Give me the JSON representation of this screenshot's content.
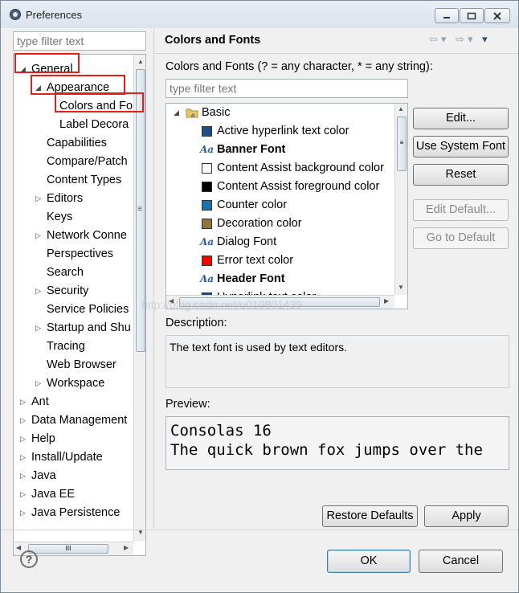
{
  "window": {
    "title": "Preferences"
  },
  "left": {
    "filter_placeholder": "type filter text",
    "tree": [
      {
        "label": "General",
        "expander": "◢",
        "level": 0
      },
      {
        "label": "Appearance",
        "expander": "◢",
        "level": 1
      },
      {
        "label": "Colors and Fo",
        "expander": "",
        "level": 2
      },
      {
        "label": "Label Decora",
        "expander": "",
        "level": 2
      },
      {
        "label": "Capabilities",
        "expander": "",
        "level": 1
      },
      {
        "label": "Compare/Patch",
        "expander": "",
        "level": 1
      },
      {
        "label": "Content Types",
        "expander": "",
        "level": 1
      },
      {
        "label": "Editors",
        "expander": "▷",
        "level": 1
      },
      {
        "label": "Keys",
        "expander": "",
        "level": 1
      },
      {
        "label": "Network Conne",
        "expander": "▷",
        "level": 1
      },
      {
        "label": "Perspectives",
        "expander": "",
        "level": 1
      },
      {
        "label": "Search",
        "expander": "",
        "level": 1
      },
      {
        "label": "Security",
        "expander": "▷",
        "level": 1
      },
      {
        "label": "Service Policies",
        "expander": "",
        "level": 1
      },
      {
        "label": "Startup and Shu",
        "expander": "▷",
        "level": 1
      },
      {
        "label": "Tracing",
        "expander": "",
        "level": 1
      },
      {
        "label": "Web Browser",
        "expander": "",
        "level": 1
      },
      {
        "label": "Workspace",
        "expander": "▷",
        "level": 1
      },
      {
        "label": "Ant",
        "expander": "▷",
        "level": 0
      },
      {
        "label": "Data Management",
        "expander": "▷",
        "level": 0
      },
      {
        "label": "Help",
        "expander": "▷",
        "level": 0
      },
      {
        "label": "Install/Update",
        "expander": "▷",
        "level": 0
      },
      {
        "label": "Java",
        "expander": "▷",
        "level": 0
      },
      {
        "label": "Java EE",
        "expander": "▷",
        "level": 0
      },
      {
        "label": "Java Persistence",
        "expander": "▷",
        "level": 0
      }
    ],
    "hscroll_grip": "III",
    "vscroll_grip": "≡"
  },
  "page": {
    "title": "Colors and Fonts",
    "nav_back": "⇦",
    "nav_forward": "⇨",
    "nav_menu": "▾",
    "subtitle": "Colors and Fonts (? = any character, * = any string):",
    "filter_placeholder": "type filter text",
    "category": {
      "label": "Basic",
      "expander": "◢"
    },
    "items": [
      {
        "label": "Active hyperlink text color",
        "kind": "color",
        "color": "#1f4e8c",
        "bold": false
      },
      {
        "label": "Banner Font",
        "kind": "font",
        "bold": true
      },
      {
        "label": "Content Assist background color",
        "kind": "color",
        "color": "#ffffff",
        "bold": false
      },
      {
        "label": "Content Assist foreground color",
        "kind": "color",
        "color": "#000000",
        "bold": false
      },
      {
        "label": "Counter color",
        "kind": "color",
        "color": "#1f6fb0",
        "bold": false
      },
      {
        "label": "Decoration color",
        "kind": "color",
        "color": "#8f7340",
        "bold": false
      },
      {
        "label": "Dialog Font",
        "kind": "font",
        "bold": false
      },
      {
        "label": "Error text color",
        "kind": "color",
        "color": "#ff0000",
        "bold": false
      },
      {
        "label": "Header Font",
        "kind": "font",
        "bold": true
      },
      {
        "label": "Hyperlink text color",
        "kind": "color",
        "color": "#1f4e8c",
        "bold": false
      }
    ],
    "font_icon": "Aa",
    "buttons": {
      "edit": "Edit...",
      "use_system_font": "Use System Font",
      "reset": "Reset",
      "edit_default": "Edit Default...",
      "go_to_default": "Go to Default"
    },
    "description_label": "Description:",
    "description_text": "The text font is used by text editors.",
    "preview_label": "Preview:",
    "preview_line1": "Consolas 16",
    "preview_line2": "The quick brown fox jumps over the",
    "restore_defaults": "Restore Defaults",
    "apply": "Apply"
  },
  "footer": {
    "ok": "OK",
    "cancel": "Cancel",
    "help": "?"
  },
  "watermark": "http://blog.csdn.net/u010801439",
  "colors": {
    "highlight": "#e0211b"
  }
}
